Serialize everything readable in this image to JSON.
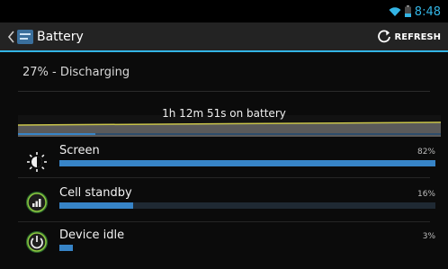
{
  "status_bar": {
    "time": "8:48"
  },
  "action_bar": {
    "title": "Battery",
    "refresh_label": "REFRESH"
  },
  "summary": {
    "text": "27% - Discharging"
  },
  "graph": {
    "label": "1h 12m 51s on battery"
  },
  "usage": [
    {
      "label": "Screen",
      "percent": "82%",
      "fraction": 0.82,
      "icon": "brightness-icon"
    },
    {
      "label": "Cell standby",
      "percent": "16%",
      "fraction": 0.16,
      "icon": "cell-signal-icon"
    },
    {
      "label": "Device idle",
      "percent": "3%",
      "fraction": 0.03,
      "icon": "power-icon"
    }
  ],
  "colors": {
    "accent": "#33b5e5",
    "bar_fill": "#3784c7",
    "graph_line": "#c9c44a"
  }
}
